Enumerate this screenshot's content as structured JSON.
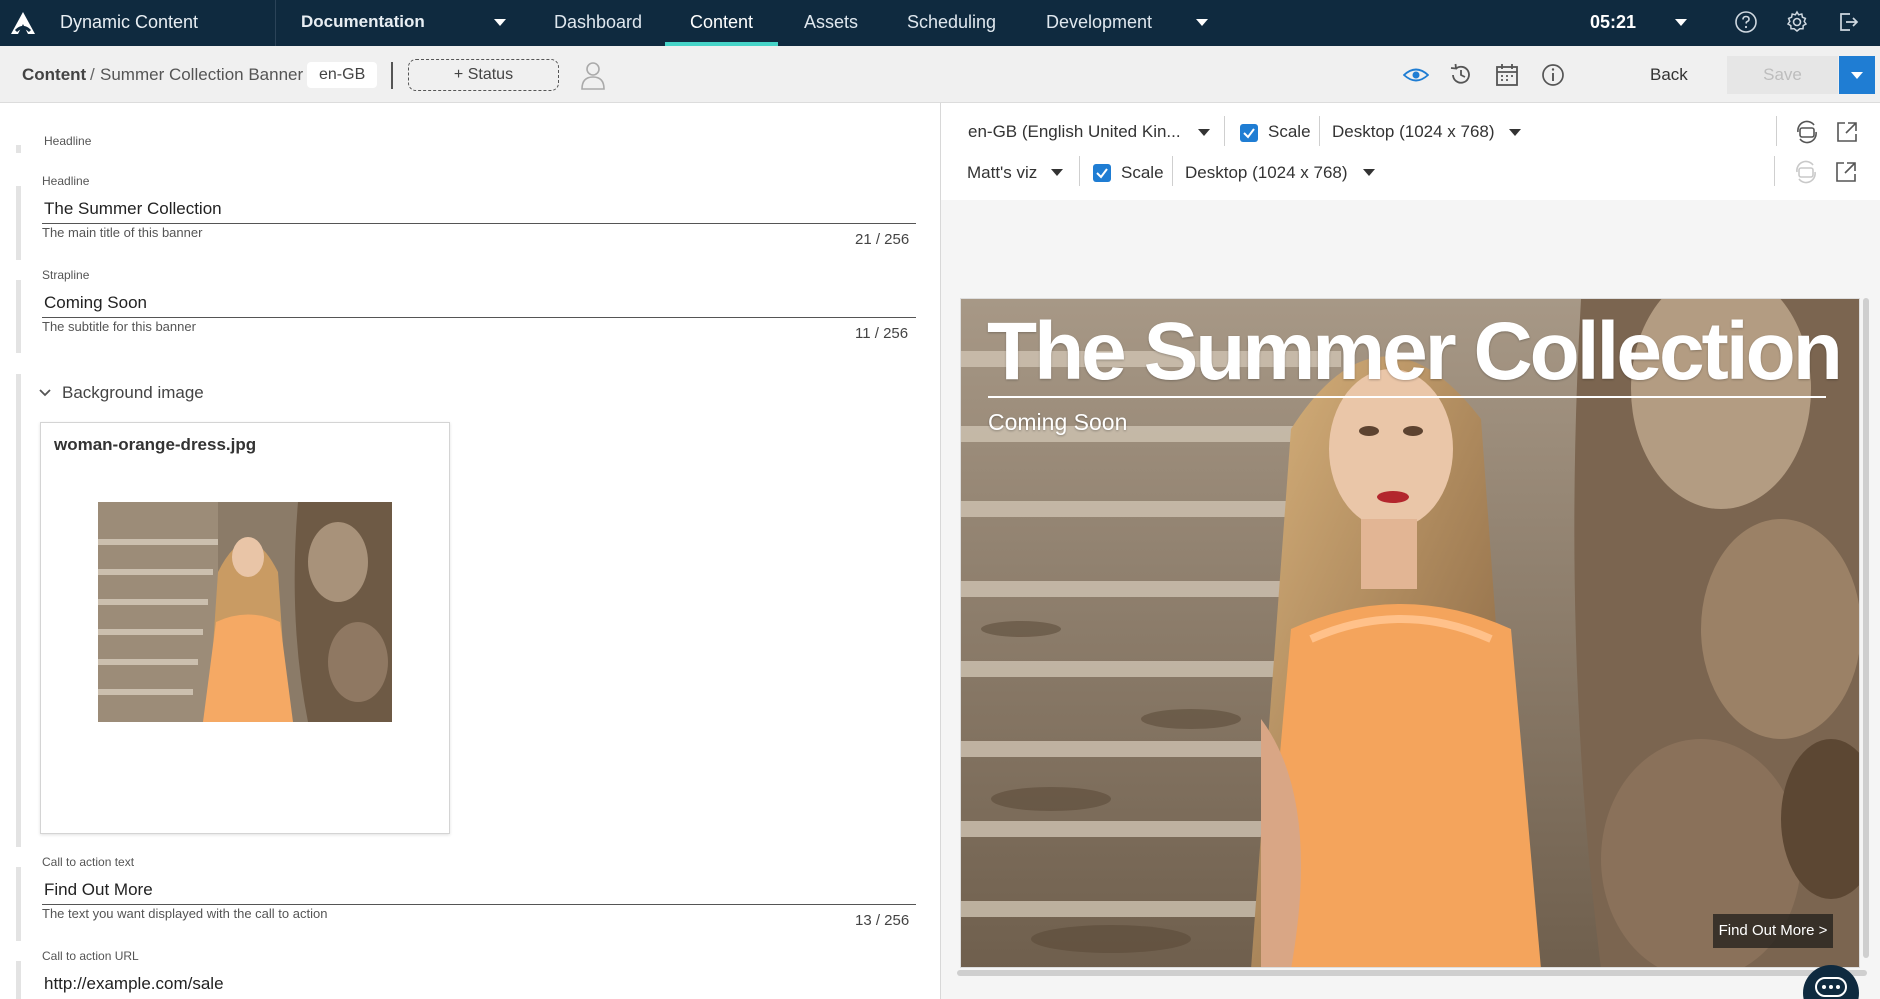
{
  "topnav": {
    "app_title": "Dynamic Content",
    "hub": "Documentation",
    "tabs": [
      {
        "label": "Dashboard"
      },
      {
        "label": "Content"
      },
      {
        "label": "Assets"
      },
      {
        "label": "Scheduling"
      },
      {
        "label": "Development"
      }
    ],
    "active_tab": "Content",
    "clock": "05:21",
    "accent_color": "#46d4c8"
  },
  "subbar": {
    "breadcrumb_root": "Content",
    "breadcrumb_separator": "/",
    "breadcrumb_page": "Summer Collection Banner",
    "locale": "en-GB",
    "status_button": "+ Status",
    "back_label": "Back",
    "save_label": "Save"
  },
  "editor": {
    "group_label": "Headline",
    "fields": [
      {
        "label": "Headline",
        "value": "The Summer Collection",
        "help": "The main title of this banner",
        "count": "21 / 256"
      },
      {
        "label": "Strapline",
        "value": "Coming Soon",
        "help": "The subtitle for this banner",
        "count": "11 / 256"
      },
      {
        "label": "Call to action text",
        "value": "Find Out More",
        "help": "The text you want displayed with the call to action",
        "count": "13 / 256"
      },
      {
        "label": "Call to action URL",
        "value": "http://example.com/sale"
      }
    ],
    "section_title": "Background image",
    "image_filename": "woman-orange-dress.jpg"
  },
  "preview": {
    "row1": {
      "locale": "en-GB (English United Kin...",
      "scale_label": "Scale",
      "device": "Desktop (1024 x 768)"
    },
    "row2": {
      "visualization": "Matt's viz",
      "scale_label": "Scale",
      "device": "Desktop (1024 x 768)"
    },
    "banner": {
      "title": "The Summer Collection",
      "subtitle": "Coming Soon",
      "cta": "Find Out More >"
    }
  }
}
